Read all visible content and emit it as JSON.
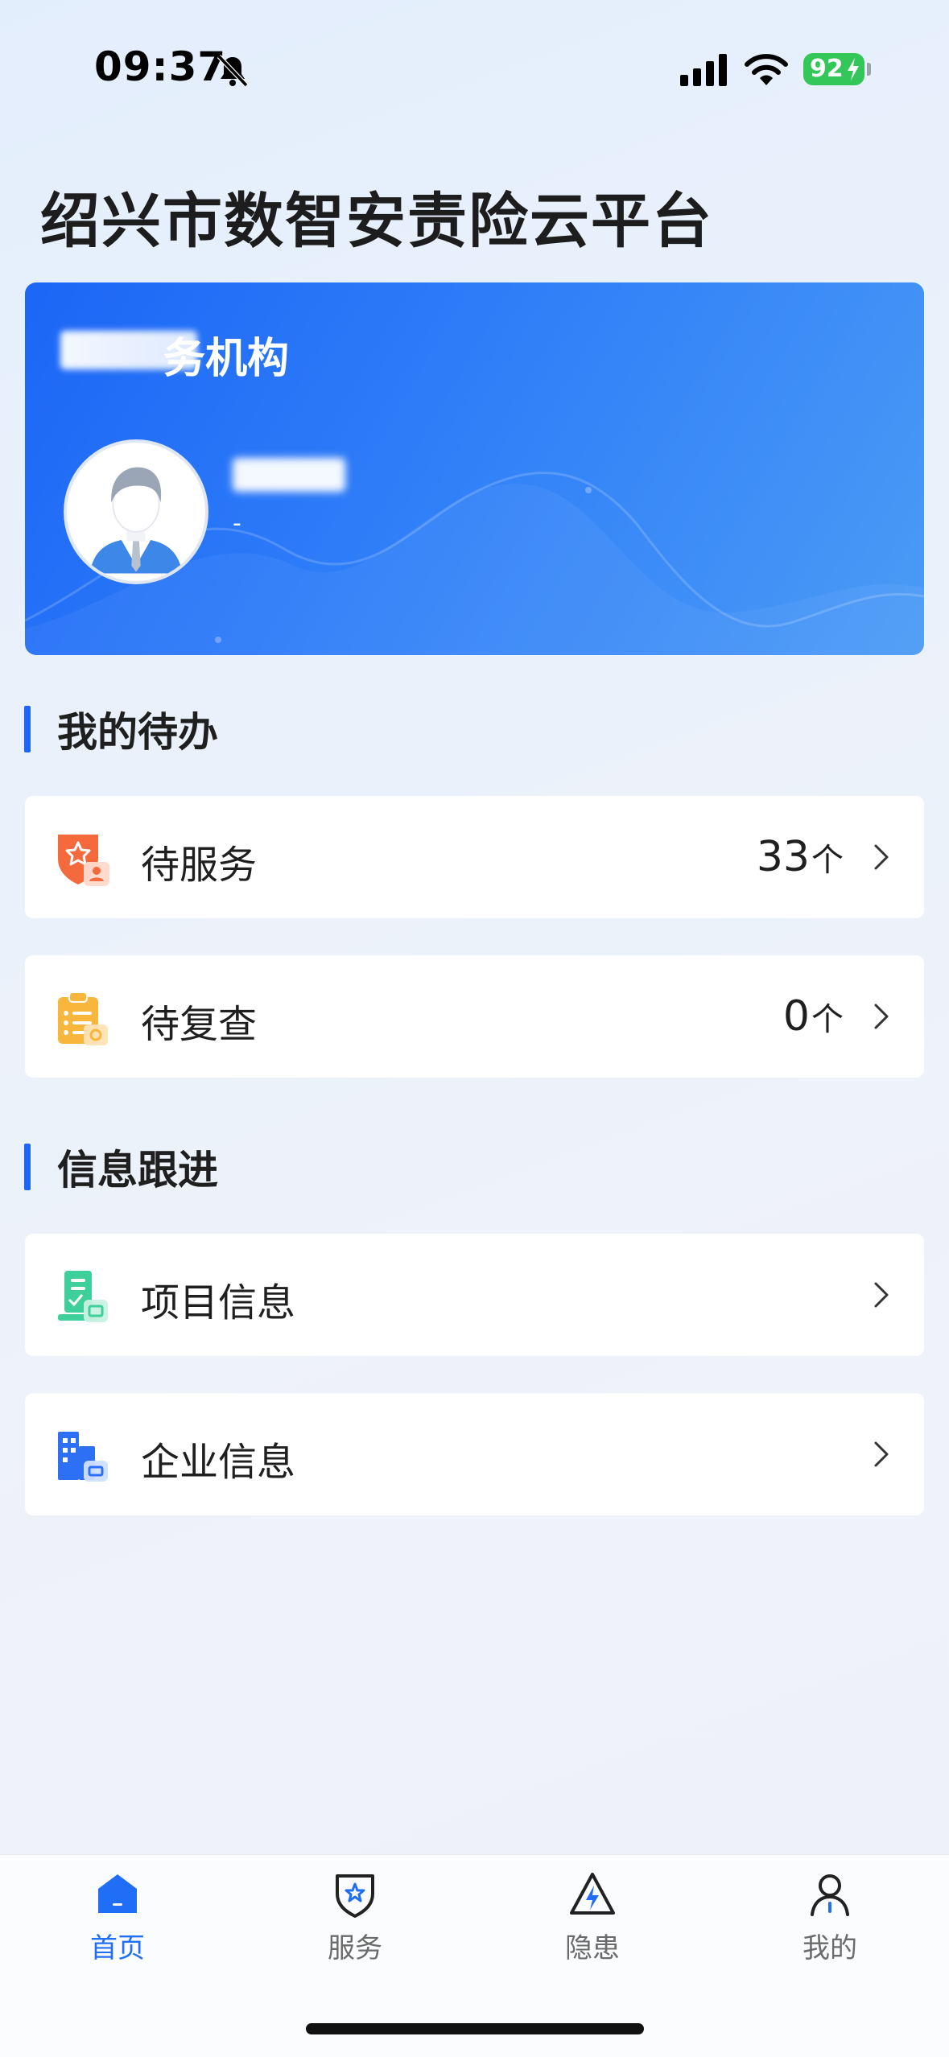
{
  "status_bar": {
    "time": "09:37",
    "battery": "92",
    "colors": {
      "battery": "#33c659"
    }
  },
  "page": {
    "title": "绍兴市数智安责险云平台"
  },
  "profile_card": {
    "org_label": "务机构",
    "user_sub": "-"
  },
  "sections": {
    "todo": {
      "title": "我的待办"
    },
    "info": {
      "title": "信息跟进"
    }
  },
  "todo_items": [
    {
      "label": "待服务",
      "count": "33",
      "unit": "个",
      "icon": "shield-star-user-icon"
    },
    {
      "label": "待复查",
      "count": "0",
      "unit": "个",
      "icon": "clipboard-check-icon"
    }
  ],
  "info_items": [
    {
      "label": "项目信息",
      "icon": "project-doc-icon"
    },
    {
      "label": "企业信息",
      "icon": "building-icon"
    }
  ],
  "tab_bar": {
    "tabs": [
      {
        "label": "首页",
        "icon": "home-icon",
        "active": true
      },
      {
        "label": "服务",
        "icon": "shield-icon",
        "active": false
      },
      {
        "label": "隐患",
        "icon": "hazard-triangle-icon",
        "active": false
      },
      {
        "label": "我的",
        "icon": "user-icon",
        "active": false
      }
    ],
    "colors": {
      "active": "#1f6ef5",
      "inactive": "#6b6b6b"
    }
  },
  "colors": {
    "accent": "#1e66f5",
    "card_gradient_start": "#1c66f6",
    "card_gradient_end": "#4b9bf6"
  }
}
